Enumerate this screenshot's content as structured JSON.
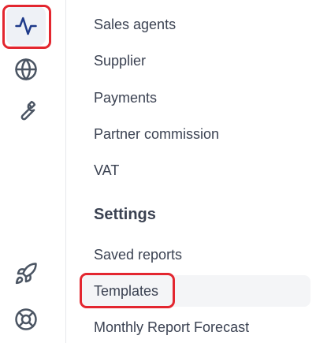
{
  "rail": {
    "icons": [
      {
        "name": "activity-icon",
        "active": true
      },
      {
        "name": "globe-icon",
        "active": false
      },
      {
        "name": "wrench-icon",
        "active": false
      },
      {
        "name": "rocket-icon",
        "active": false
      },
      {
        "name": "lifebuoy-icon",
        "active": false
      }
    ]
  },
  "menu": {
    "items": [
      {
        "label": "Sales agents"
      },
      {
        "label": "Supplier"
      },
      {
        "label": "Payments"
      },
      {
        "label": "Partner commission"
      },
      {
        "label": "VAT"
      }
    ],
    "settings_heading": "Settings",
    "settings_items": [
      {
        "label": "Saved reports"
      },
      {
        "label": "Templates",
        "selected": true
      },
      {
        "label": "Monthly Report Forecast"
      }
    ]
  },
  "colors": {
    "highlight": "#e3262f",
    "active_icon": "#1e3a8a",
    "text": "#3b4252"
  }
}
